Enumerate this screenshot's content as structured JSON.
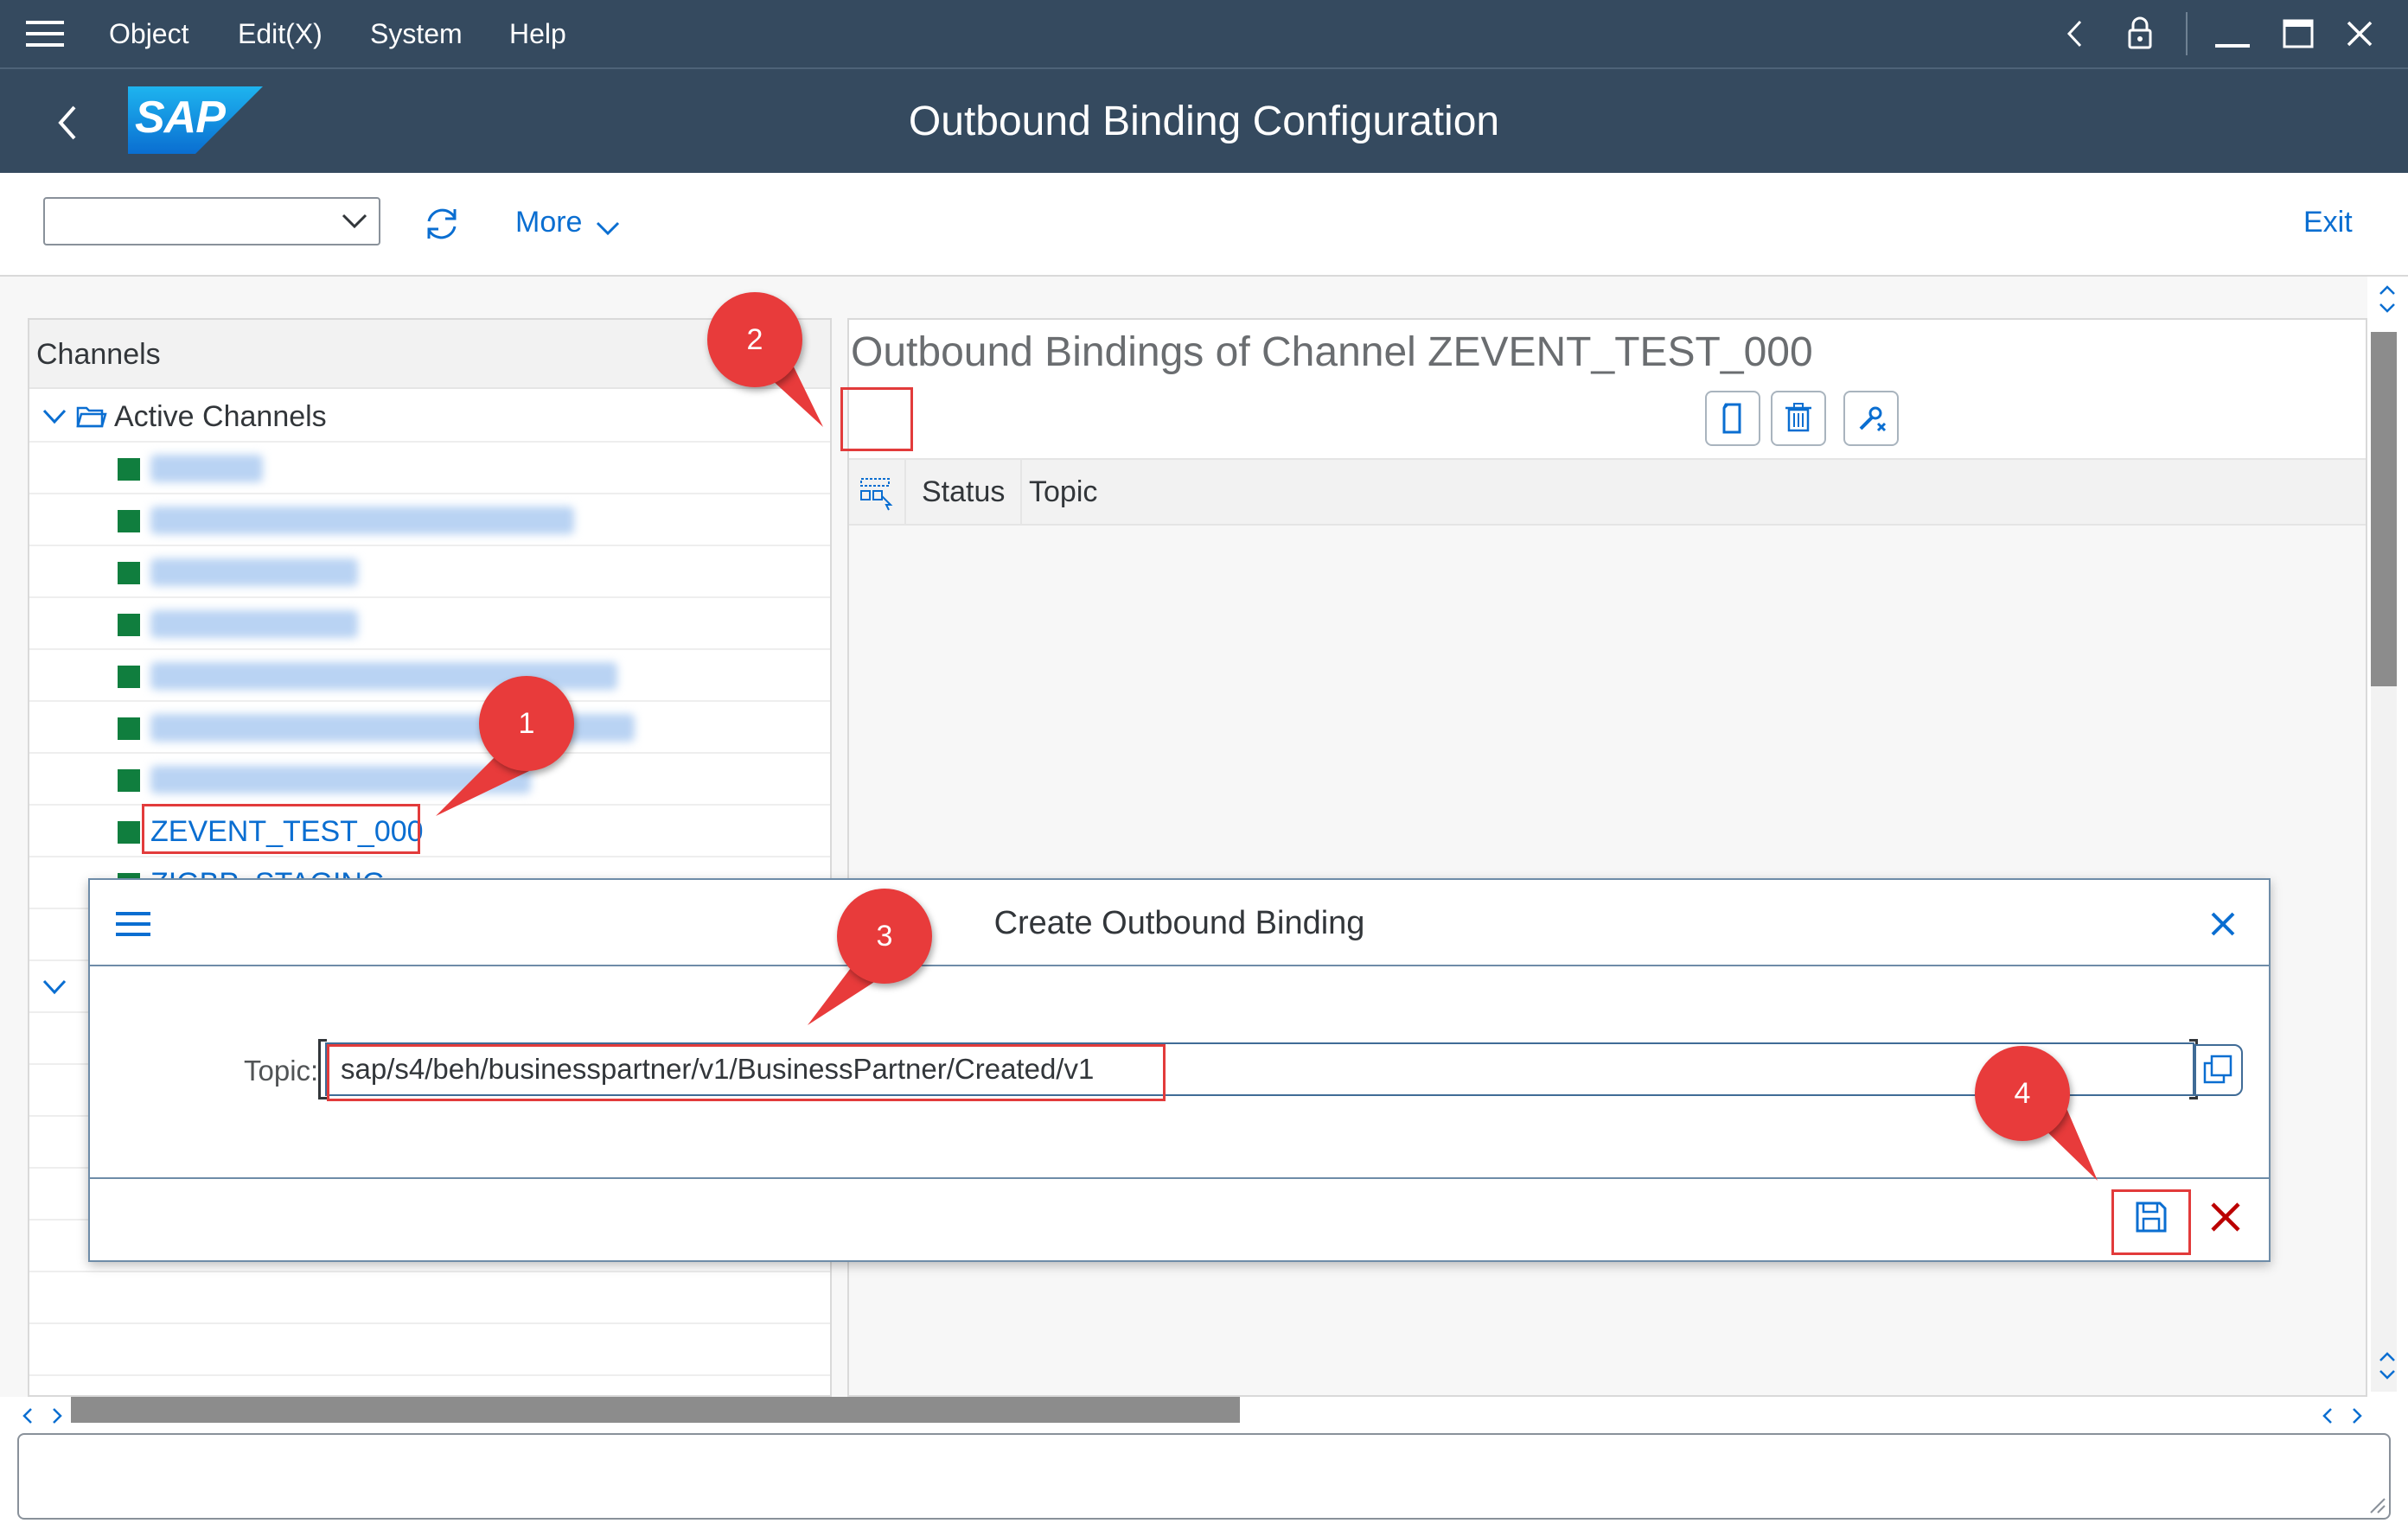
{
  "menubar": {
    "items": [
      "Object",
      "Edit(X)",
      "System",
      "Help"
    ]
  },
  "header": {
    "title": "Outbound Binding Configuration",
    "logo_text": "SAP"
  },
  "toolbar": {
    "combo_value": "",
    "more_label": "More",
    "exit_label": "Exit"
  },
  "left_panel": {
    "header": "Channels",
    "active_node_label": "Active Channels",
    "selected_channel": "ZEVENT_TEST_000",
    "partial_channel": "ZIGBP_STAGING",
    "channel_status_color": "#107e3e"
  },
  "right_panel": {
    "title": "Outbound Bindings of Channel ZEVENT_TEST_000",
    "columns": [
      "Status",
      "Topic"
    ]
  },
  "dialog": {
    "title": "Create Outbound Binding",
    "topic_label": "Topic:",
    "topic_value": "sap/s4/beh/businesspartner/v1/BusinessPartner/Created/v1"
  },
  "callouts": [
    "1",
    "2",
    "3",
    "4"
  ],
  "colors": {
    "shell": "#354a5f",
    "link": "#0a6ed1",
    "callout": "#e83b3b",
    "cancel": "#bb0000"
  }
}
